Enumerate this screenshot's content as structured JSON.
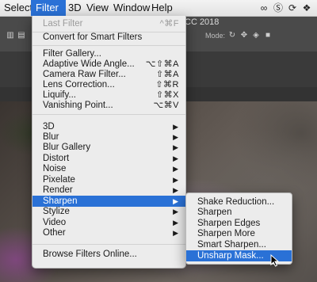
{
  "app": {
    "title": "CC 2018",
    "mode_label": "Mode:"
  },
  "menubar": {
    "items": [
      "Select",
      "Filter",
      "3D",
      "View",
      "Window",
      "Help"
    ],
    "active_index": 1
  },
  "tray_icons": [
    "creative-cloud-icon",
    "skype-icon",
    "sync-icon",
    "dropbox-icon"
  ],
  "filter_menu": {
    "last_filter": {
      "label": "Last Filter",
      "shortcut": "^⌘F"
    },
    "convert": "Convert for Smart Filters",
    "group1": [
      {
        "label": "Filter Gallery...",
        "shortcut": ""
      },
      {
        "label": "Adaptive Wide Angle...",
        "shortcut": "⌥⇧⌘A"
      },
      {
        "label": "Camera Raw Filter...",
        "shortcut": "⇧⌘A"
      },
      {
        "label": "Lens Correction...",
        "shortcut": "⇧⌘R"
      },
      {
        "label": "Liquify...",
        "shortcut": "⇧⌘X"
      },
      {
        "label": "Vanishing Point...",
        "shortcut": "⌥⌘V"
      }
    ],
    "submenus": [
      "3D",
      "Blur",
      "Blur Gallery",
      "Distort",
      "Noise",
      "Pixelate",
      "Render",
      "Sharpen",
      "Stylize",
      "Video",
      "Other"
    ],
    "highlighted_submenu": "Sharpen",
    "browse": "Browse Filters Online..."
  },
  "sharpen_submenu": {
    "items": [
      "Shake Reduction...",
      "Sharpen",
      "Sharpen Edges",
      "Sharpen More",
      "Smart Sharpen...",
      "Unsharp Mask..."
    ],
    "highlighted": "Unsharp Mask..."
  },
  "colors": {
    "highlight": "#2a71d6",
    "menu_bg": "#ececec"
  }
}
